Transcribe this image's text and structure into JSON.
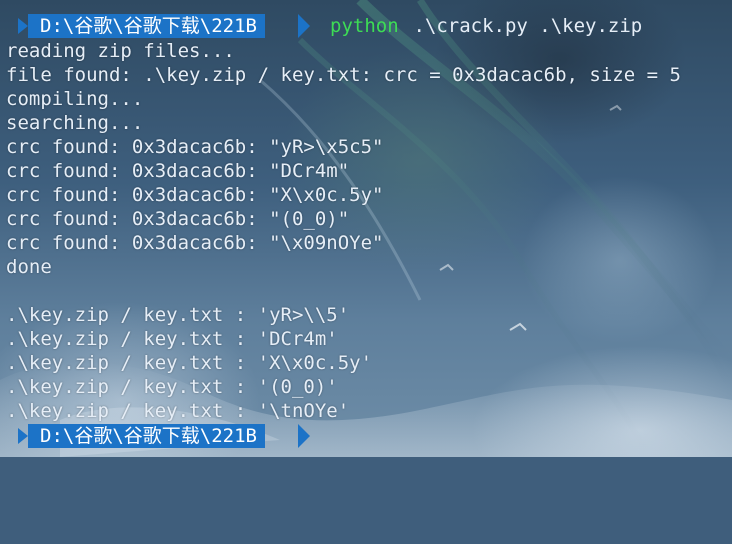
{
  "prompt": {
    "path": "D:\\谷歌\\谷歌下载\\221B",
    "command": "python",
    "args": " .\\crack.py .\\key.zip",
    "colors": {
      "path_bg": "#1c73c7",
      "command": "#3ddc55",
      "text": "#e6eef7"
    }
  },
  "output": {
    "lines": [
      "reading zip files...",
      "file found: .\\key.zip / key.txt: crc = 0x3dacac6b, size = 5",
      "compiling...",
      "searching...",
      "crc found: 0x3dacac6b: \"yR>\\x5c5\"",
      "crc found: 0x3dacac6b: \"DCr4m\"",
      "crc found: 0x3dacac6b: \"X\\x0c.5y\"",
      "crc found: 0x3dacac6b: \"(0_0)\"",
      "crc found: 0x3dacac6b: \"\\x09nOYe\"",
      "done",
      "",
      ".\\key.zip / key.txt : 'yR>\\\\5'",
      ".\\key.zip / key.txt : 'DCr4m'",
      ".\\key.zip / key.txt : 'X\\x0c.5y'",
      ".\\key.zip / key.txt : '(0_0)'",
      ".\\key.zip / key.txt : '\\tnOYe'"
    ]
  },
  "next_prompt": {
    "path": "D:\\谷歌\\谷歌下载\\221B"
  },
  "background": {
    "description_colors": [
      "#2f4a62",
      "#3e5f7e",
      "#6f8ea8"
    ]
  }
}
